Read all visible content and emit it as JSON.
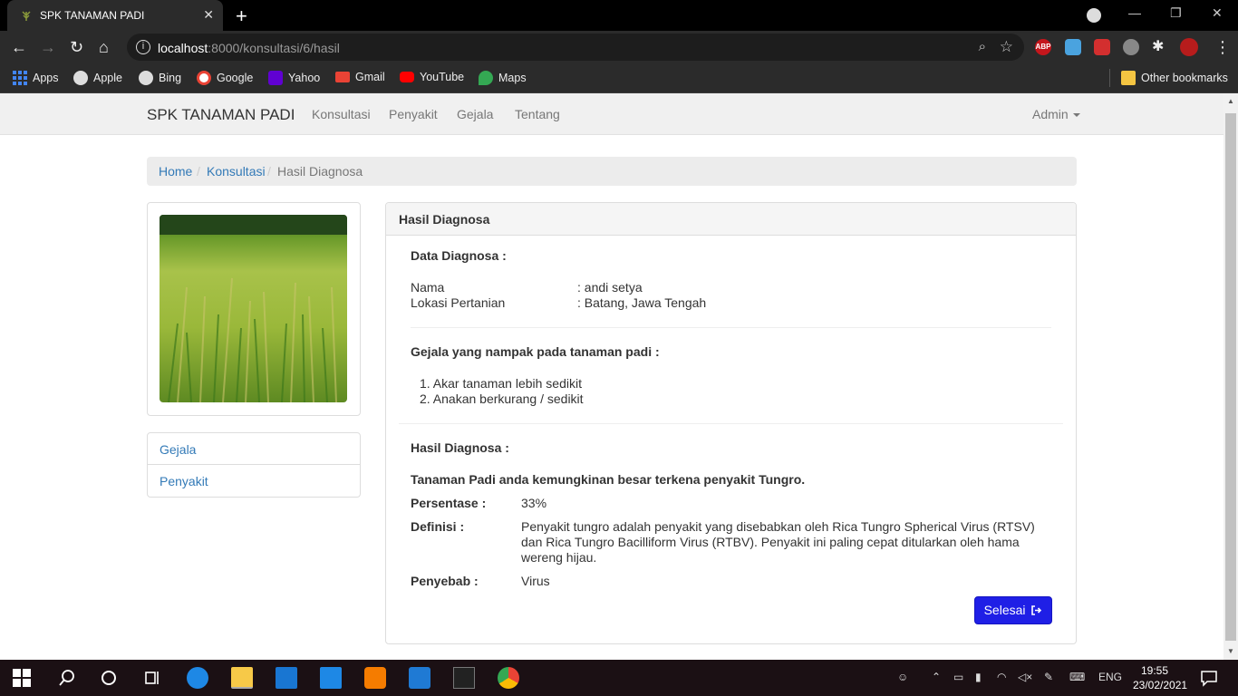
{
  "browser": {
    "tab_title": "SPK TANAMAN PADI",
    "url_host": "localhost",
    "url_rest": ":8000/konsultasi/6/hasil",
    "bookmarks": [
      "Apps",
      "Apple",
      "Bing",
      "Google",
      "Yahoo",
      "Gmail",
      "YouTube",
      "Maps"
    ],
    "other_bookmarks": "Other bookmarks",
    "ext_abp": "ABP"
  },
  "navbar": {
    "brand": "SPK TANAMAN PADI",
    "links": [
      "Konsultasi",
      "Penyakit",
      "Gejala",
      "Tentang"
    ],
    "admin": "Admin"
  },
  "breadcrumb": {
    "home": "Home",
    "konsultasi": "Konsultasi",
    "sep": "/",
    "active": "Hasil Diagnosa"
  },
  "sidebar": {
    "items": [
      "Gejala",
      "Penyakit"
    ]
  },
  "panel": {
    "heading": "Hasil Diagnosa",
    "data_title": "Data Diagnosa :",
    "nama_label": "Nama",
    "nama_value": ": andi setya",
    "lokasi_label": "Lokasi Pertanian",
    "lokasi_value": ": Batang, Jawa Tengah",
    "gejala_title": "Gejala yang nampak pada tanaman padi :",
    "gejala": [
      "1. Akar tanaman lebih sedikit",
      "2. Anakan berkurang / sedikit"
    ],
    "hasil_title": "Hasil Diagnosa :",
    "kesimpulan": "Tanaman Padi anda kemungkinan besar terkena penyakit Tungro.",
    "persentase_label": "Persentase :",
    "persentase_value": "33%",
    "definisi_label": "Definisi :",
    "definisi_lines": [
      "Penyakit tungro adalah penyakit yang disebabkan oleh Rica Tungro Spherical Virus (RTSV)",
      "dan Rica Tungro Bacilliform Virus (RTBV). Penyakit ini paling cepat ditularkan oleh hama",
      "wereng hijau."
    ],
    "penyebab_label": "Penyebab :",
    "penyebab_value": "Virus",
    "button": "Selesai"
  },
  "taskbar": {
    "lang": "ENG",
    "time": "19:55",
    "date": "23/02/2021"
  }
}
